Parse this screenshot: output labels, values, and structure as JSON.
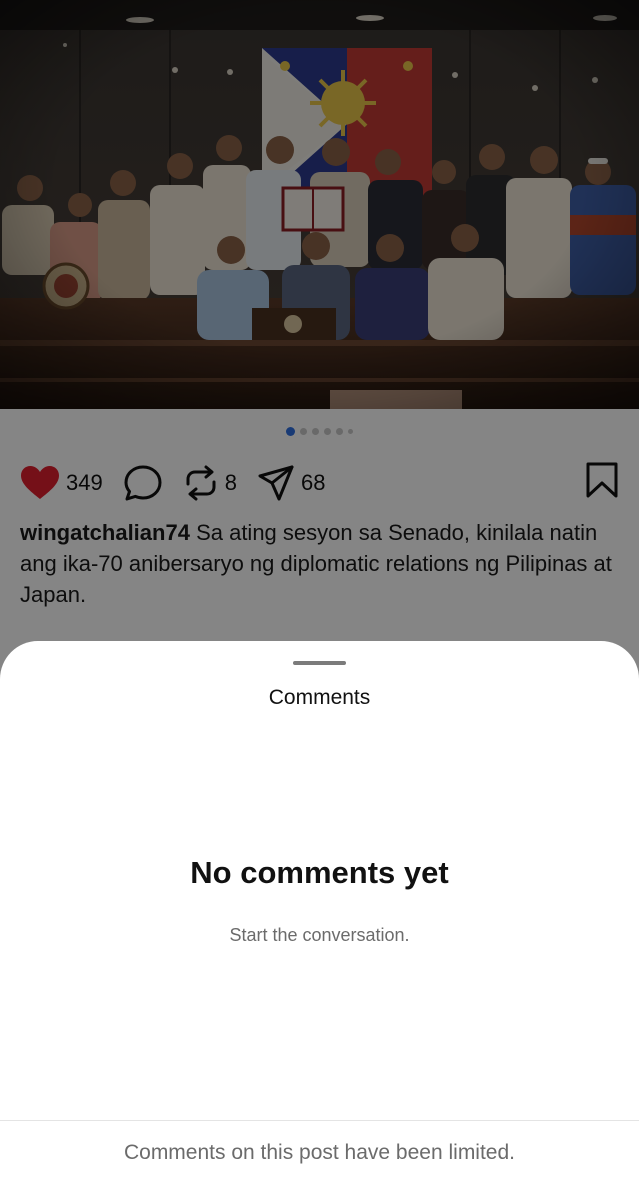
{
  "post": {
    "carousel": {
      "total": 6,
      "active_index": 0
    },
    "likes": "349",
    "reposts": "8",
    "shares": "68",
    "username": "wingatchalian74",
    "caption": " Sa ating sesyon sa Senado, kinilala natin ang ika-70 anibersaryo ng diplomatic relations ng Pilipinas at Japan.",
    "caption_more": ".",
    "colors": {
      "like_red": "#e0202f",
      "carousel_active": "#2f6fe0"
    }
  },
  "comments_sheet": {
    "title": "Comments",
    "empty_title": "No comments yet",
    "empty_subtitle": "Start the conversation.",
    "limited_notice": "Comments on this post have been limited."
  },
  "icons": [
    "heart-icon",
    "comment-icon",
    "repost-icon",
    "share-icon",
    "bookmark-icon"
  ]
}
